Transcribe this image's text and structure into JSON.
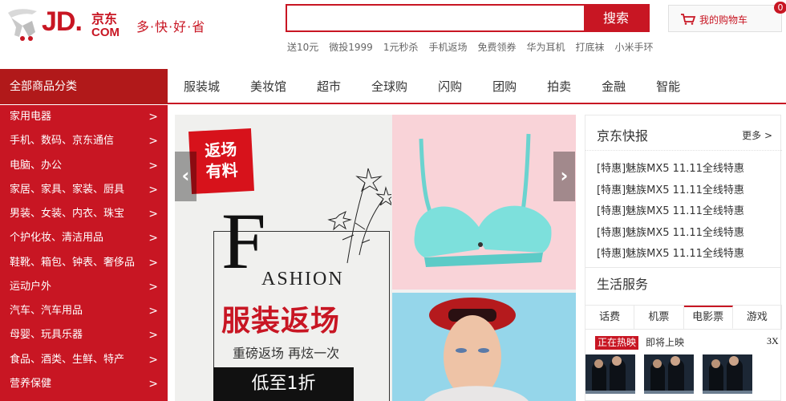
{
  "header": {
    "logo_jd": "JD.",
    "logo_cn": "京东",
    "logo_com": "COM",
    "slogan": "多·快·好·省"
  },
  "search": {
    "value": "",
    "button_label": "搜索",
    "hotwords": [
      "送10元",
      "微投1999",
      "1元秒杀",
      "手机返场",
      "免费领券",
      "华为耳机",
      "打底袜",
      "小米手环"
    ]
  },
  "cart": {
    "label": "我的购物车",
    "count": "0",
    "icon": "cart-icon"
  },
  "nav": {
    "category_title": "全部商品分类",
    "items": [
      "服装城",
      "美妆馆",
      "超市",
      "全球购",
      "闪购",
      "团购",
      "拍卖",
      "金融",
      "智能"
    ]
  },
  "categories": [
    "家用电器",
    "手机、数码、京东通信",
    "电脑、办公",
    "家居、家具、家装、厨具",
    "男装、女装、内衣、珠宝",
    "个护化妆、清洁用品",
    "鞋靴、箱包、钟表、奢侈品",
    "运动户外",
    "汽车、汽车用品",
    "母婴、玩具乐器",
    "食品、酒类、生鲜、特产",
    "营养保健"
  ],
  "banner": {
    "badge_line1": "返场",
    "badge_line2": "有料",
    "big_letter": "F",
    "fashion_word": "ASHION",
    "title": "服装返场",
    "subtitle": "重磅返场 再炫一次",
    "cta": "低至1折",
    "prev_arrow": "‹",
    "next_arrow": "›"
  },
  "news": {
    "title": "京东快报",
    "more": "更多 >",
    "items": [
      "[特惠]魅族MX5 11.11全线特惠",
      "[特惠]魅族MX5 11.11全线特惠",
      "[特惠]魅族MX5 11.11全线特惠",
      "[特惠]魅族MX5 11.11全线特惠",
      "[特惠]魅族MX5 11.11全线特惠"
    ]
  },
  "services": {
    "title": "生活服务",
    "tabs": [
      "话费",
      "机票",
      "电影票",
      "游戏"
    ],
    "active_tab": "电影票",
    "now_showing": "正在热映",
    "coming_soon": "即将上映",
    "extra": "3X"
  },
  "colors": {
    "brand_red": "#c81623",
    "sidebar_red": "#b1191a"
  }
}
